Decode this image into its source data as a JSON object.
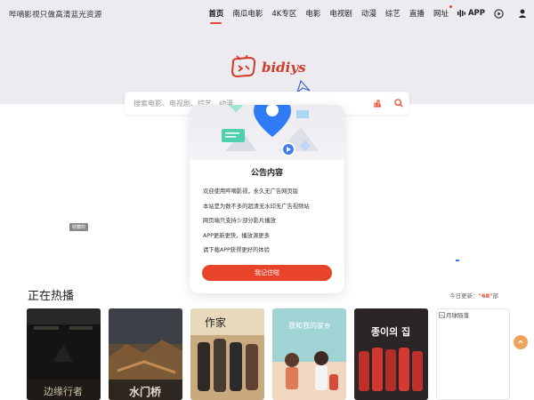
{
  "header": {
    "site_name": "哔嘀影视只做高清蓝光资源",
    "nav": [
      {
        "label": "首页",
        "active": true
      },
      {
        "label": "南瓜电影"
      },
      {
        "label": "4K专区"
      },
      {
        "label": "电影"
      },
      {
        "label": "电视剧"
      },
      {
        "label": "动漫"
      },
      {
        "label": "综艺"
      },
      {
        "label": "直播"
      },
      {
        "label": "网址",
        "dot": true
      }
    ],
    "app_label": "APP"
  },
  "logo_text": "bidiys",
  "search": {
    "placeholder": "搜索电影、电视剧、综艺、动漫"
  },
  "ad_tag": "收藏的",
  "popup": {
    "title": "公告内容",
    "lines": [
      "欢迎使用哔嘀影视，永久无广告网页版",
      "本站是为数不多的超清无水印无广告视频站",
      "网页端只支持少部分影片播放",
      "APP更新更快，播放源更多",
      "请下载APP获得更好的体验"
    ],
    "button_label": "我记住啦"
  },
  "hot": {
    "title": "正在热播",
    "update_prefix": "今日更新：",
    "update_count": "\"68\"",
    "update_suffix": "部",
    "posters": [
      {
        "title": "边缘行者"
      },
      {
        "title": "水门桥"
      },
      {
        "title": "作家"
      },
      {
        "title": "我和我的家乡"
      },
      {
        "title": "종이의 집"
      },
      {
        "title": "月球陨落",
        "broken": true
      }
    ]
  },
  "colors": {
    "accent": "#e8442a",
    "hero_bg": "#ebebf0",
    "pin_blue": "#2f7bf5",
    "float_button": "#f0a25c"
  }
}
